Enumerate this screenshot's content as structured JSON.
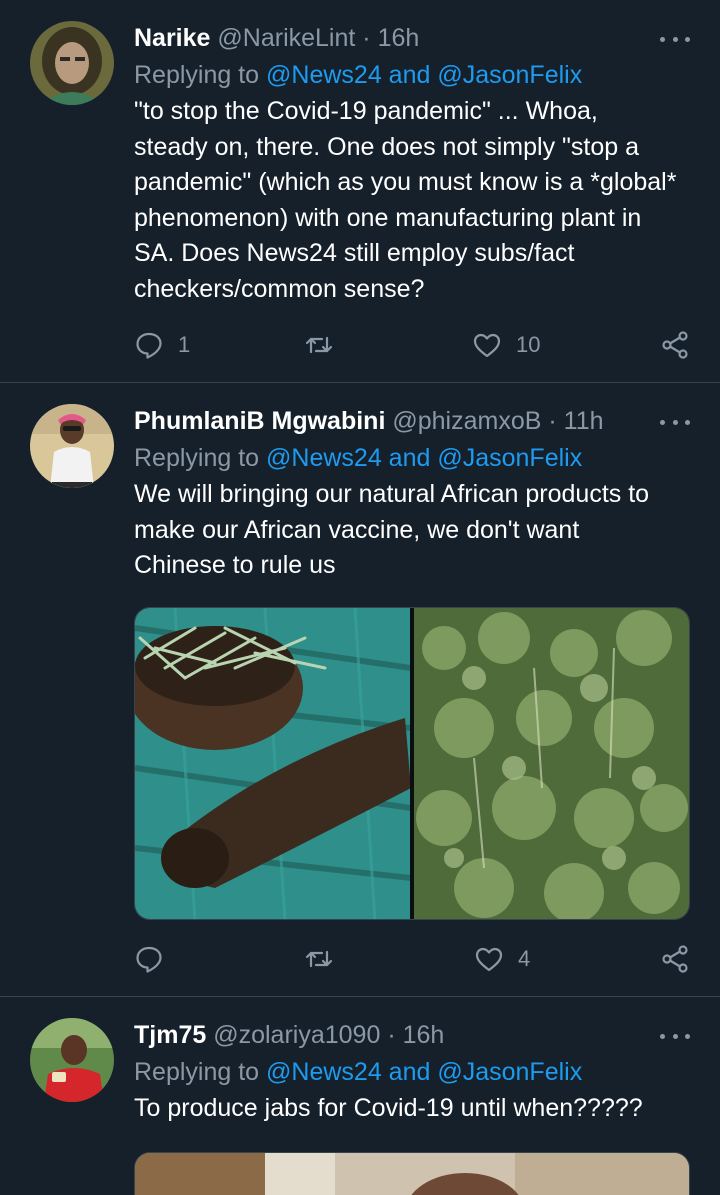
{
  "tweets": [
    {
      "name": "Narike",
      "handle": "@NarikeLint",
      "time": "16h",
      "replying_prefix": "Replying to",
      "replying_mentions": "@News24 and @JasonFelix",
      "text_lines": [
        "\"to stop the Covid-19 pandemic\" ... Whoa,",
        "steady on, there. One does not simply \"stop a",
        "pandemic\" (which as you must know is a *global*",
        "phenomenon) with one manufacturing plant in",
        "SA. Does News24 still employ subs/fact",
        "checkers/common sense?"
      ],
      "reply_count": "1",
      "retweet_count": "",
      "like_count": "10"
    },
    {
      "name": "PhumlaniB Mgwabini",
      "handle": "@phizamxoB",
      "time": "11h",
      "replying_prefix": "Replying to",
      "replying_mentions": "@News24 and @JasonFelix",
      "text_lines": [
        "We will bringing our natural African products to",
        "make our African vaccine,  we don't want",
        "Chinese to rule us"
      ],
      "reply_count": "",
      "retweet_count": "",
      "like_count": "4"
    },
    {
      "name": "Tjm75",
      "handle": "@zolariya1090",
      "time": "16h",
      "replying_prefix": "Replying to",
      "replying_mentions": "@News24 and @JasonFelix",
      "text_lines": [
        "To produce jabs for Covid-19 until when?????"
      ]
    }
  ],
  "separator": "·",
  "icons": {
    "reply": "comment-bubble-icon",
    "retweet": "retweet-icon",
    "like": "heart-icon",
    "share": "share-icon",
    "more": "more-options-icon"
  },
  "colors": {
    "background": "#15202b",
    "text": "#ffffff",
    "muted": "#8b98a5",
    "link": "#1d9bf0",
    "divider": "#38444d"
  }
}
